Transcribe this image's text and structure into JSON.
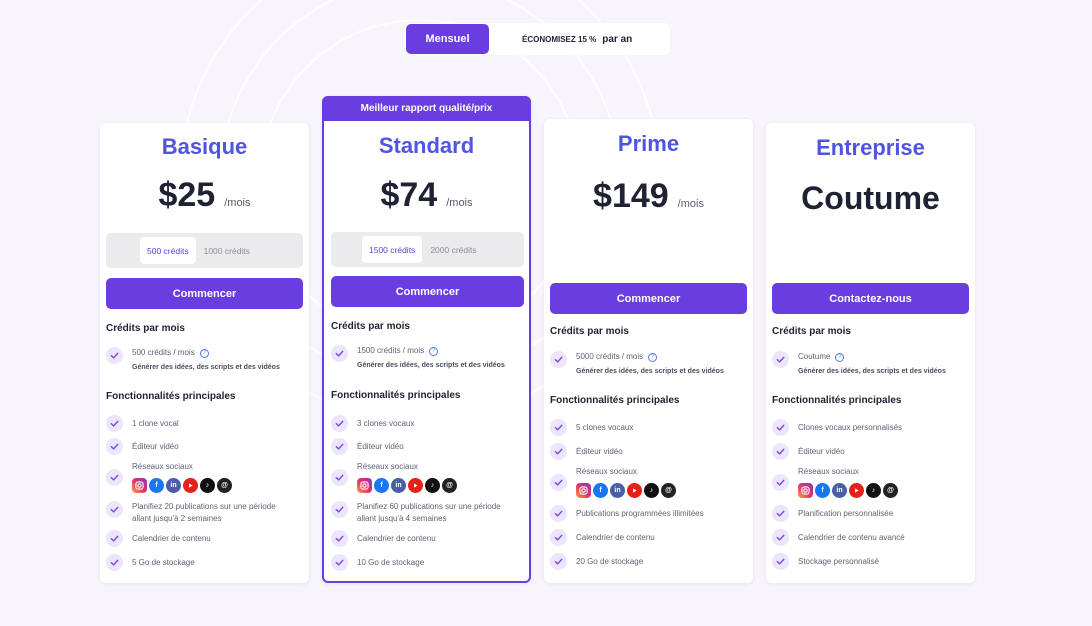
{
  "billing": {
    "monthly_label": "Mensuel",
    "save_label": "ÉCONOMISEZ 15 %",
    "yearly_label": "par an"
  },
  "colors": {
    "accent": "#6a3de0",
    "plan_name": "#4f55e0",
    "check_bg": "#ece5fb"
  },
  "social_icons": [
    "instagram-icon",
    "facebook-icon",
    "linkedin-icon",
    "youtube-icon",
    "tiktok-icon",
    "threads-icon"
  ],
  "plans": [
    {
      "name": "Basique",
      "price": "$25",
      "per": "/mois",
      "credit_options": [
        "500 crédits",
        "1000 crédits"
      ],
      "cta": "Commencer",
      "credits_title": "Crédits par mois",
      "credits_line": "500 crédits / mois",
      "credits_sub": "Générer des idées, des scripts et des vidéos",
      "features_title": "Fonctionnalités principales",
      "features": [
        "1 clone vocal",
        "Éditeur vidéo",
        "Réseaux sociaux",
        "Planifiez 20 publications sur une période allant jusqu'à 2 semaines",
        "Calendrier de contenu",
        "5 Go de stockage"
      ]
    },
    {
      "name": "Standard",
      "banner": "Meilleur rapport qualité/prix",
      "price": "$74",
      "per": "/mois",
      "credit_options": [
        "1500 crédits",
        "2000 crédits"
      ],
      "cta": "Commencer",
      "credits_title": "Crédits par mois",
      "credits_line": "1500 crédits / mois",
      "credits_sub": "Générer des idées, des scripts et des vidéos",
      "features_title": "Fonctionnalités principales",
      "features": [
        "3 clones vocaux",
        "Éditeur vidéo",
        "Réseaux sociaux",
        "Planifiez 60 publications sur une période allant jusqu'à 4 semaines",
        "Calendrier de contenu",
        "10 Go de stockage"
      ]
    },
    {
      "name": "Prime",
      "price": "$149",
      "per": "/mois",
      "cta": "Commencer",
      "credits_title": "Crédits par mois",
      "credits_line": "5000 crédits / mois",
      "credits_sub": "Générer des idées, des scripts et des vidéos",
      "features_title": "Fonctionnalités principales",
      "features": [
        "5 clones vocaux",
        "Éditeur vidéo",
        "Réseaux sociaux",
        "Publications programmées illimitées",
        "Calendrier de contenu",
        "20 Go de stockage"
      ]
    },
    {
      "name": "Entreprise",
      "price": "Coutume",
      "cta": "Contactez-nous",
      "credits_title": "Crédits par mois",
      "credits_line": "Coutume",
      "credits_sub": "Générer des idées, des scripts et des vidéos",
      "features_title": "Fonctionnalités principales",
      "features": [
        "Clones vocaux personnalisés",
        "Éditeur vidéo",
        "Réseaux sociaux",
        "Planification personnalisée",
        "Calendrier de contenu avancé",
        "Stockage personnalisé"
      ]
    }
  ]
}
